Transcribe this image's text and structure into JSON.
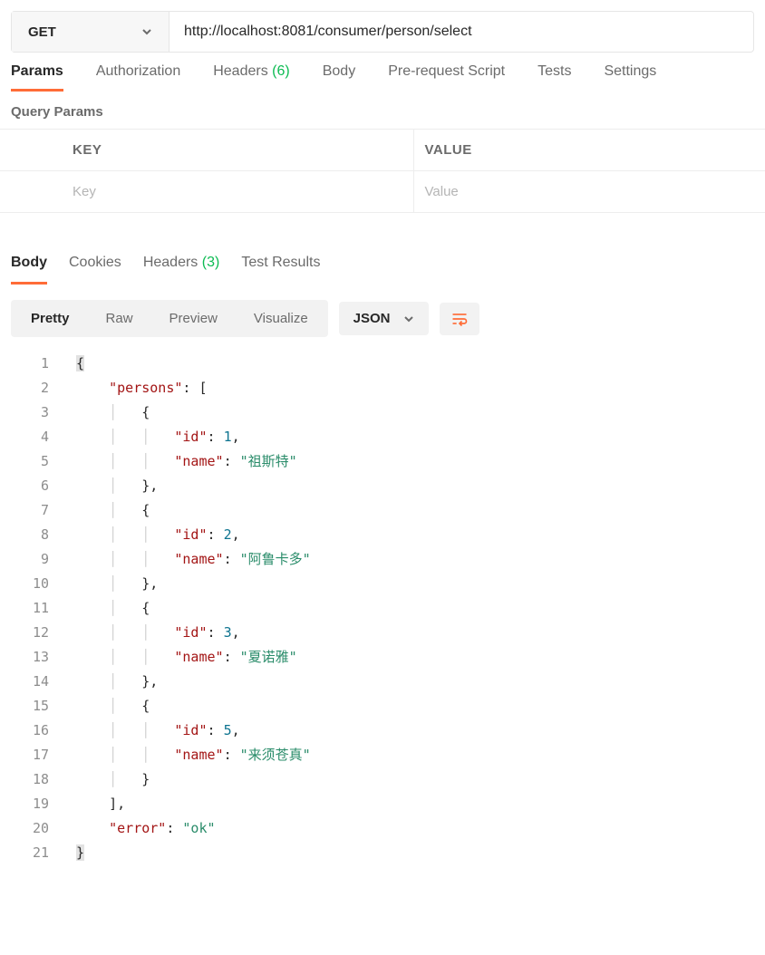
{
  "request": {
    "method": "GET",
    "url": "http://localhost:8081/consumer/person/select"
  },
  "request_tabs": {
    "params": "Params",
    "authorization": "Authorization",
    "headers_label": "Headers",
    "headers_count": "(6)",
    "body": "Body",
    "pre_request": "Pre-request Script",
    "tests": "Tests",
    "settings": "Settings"
  },
  "query_params": {
    "title": "Query Params",
    "key_header": "KEY",
    "value_header": "VALUE",
    "key_placeholder": "Key",
    "value_placeholder": "Value"
  },
  "response_tabs": {
    "body": "Body",
    "cookies": "Cookies",
    "headers_label": "Headers",
    "headers_count": "(3)",
    "test_results": "Test Results"
  },
  "view": {
    "pretty": "Pretty",
    "raw": "Raw",
    "preview": "Preview",
    "visualize": "Visualize",
    "format": "JSON"
  },
  "response_body": {
    "persons": [
      {
        "id": 1,
        "name": "祖斯特"
      },
      {
        "id": 2,
        "name": "阿鲁卡多"
      },
      {
        "id": 3,
        "name": "夏诺雅"
      },
      {
        "id": 5,
        "name": "来须苍真"
      }
    ],
    "error": "ok"
  },
  "chart_data": {
    "type": "table",
    "title": "persons",
    "columns": [
      "id",
      "name"
    ],
    "rows": [
      [
        1,
        "祖斯特"
      ],
      [
        2,
        "阿鲁卡多"
      ],
      [
        3,
        "夏诺雅"
      ],
      [
        5,
        "来须苍真"
      ]
    ],
    "meta": {
      "error": "ok"
    }
  }
}
